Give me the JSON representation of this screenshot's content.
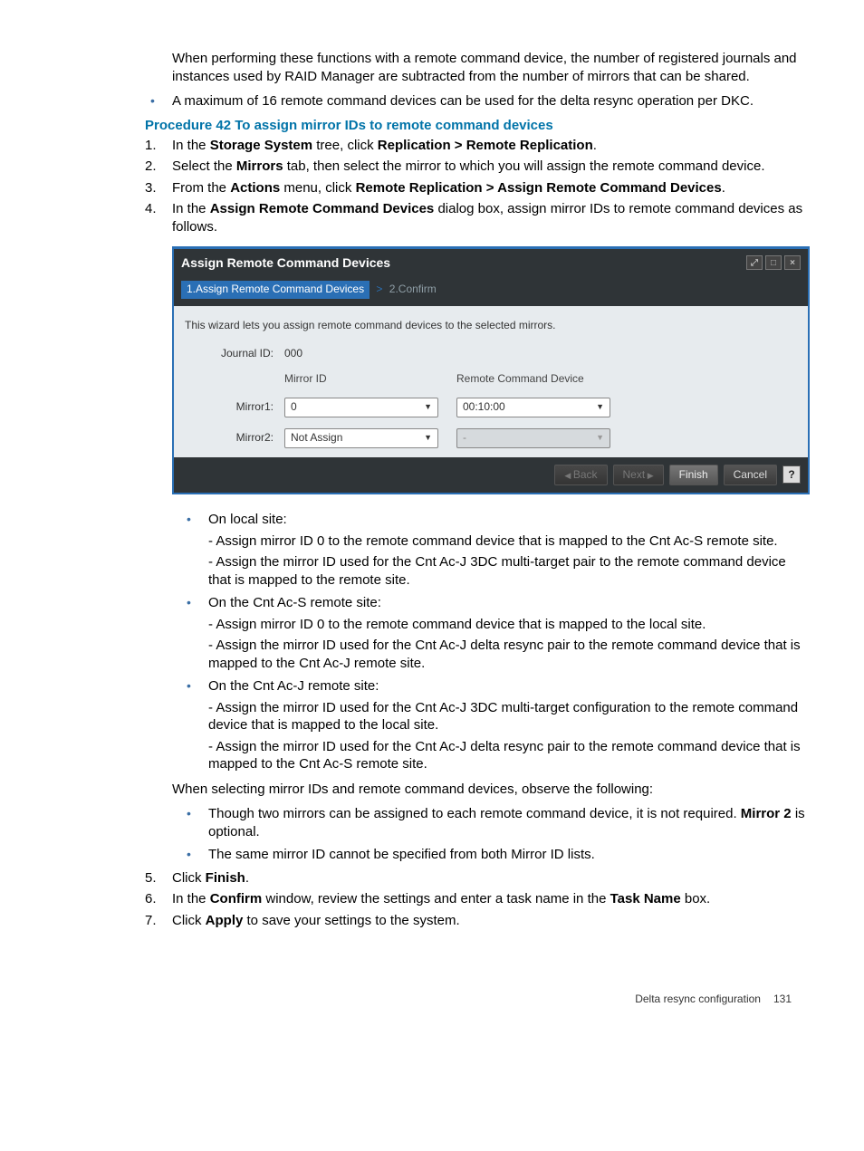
{
  "intro": {
    "p1": "When performing these functions with a remote command device, the number of registered journals and instances used by RAID Manager are subtracted from the number of mirrors that can be shared.",
    "b1": "A maximum of 16 remote command devices can be used for the delta resync operation per DKC."
  },
  "procedure_title": "Procedure 42 To assign mirror IDs to remote command devices",
  "steps": {
    "s1a": "In the ",
    "s1b": "Storage System",
    "s1c": " tree, click ",
    "s1d": "Replication > Remote Replication",
    "s1e": ".",
    "s2a": "Select the ",
    "s2b": "Mirrors",
    "s2c": " tab, then select the mirror to which you will assign the remote command device.",
    "s3a": "From the ",
    "s3b": "Actions",
    "s3c": " menu, click ",
    "s3d": "Remote Replication > Assign Remote Command Devices",
    "s3e": ".",
    "s4a": "In the ",
    "s4b": "Assign Remote Command Devices",
    "s4c": " dialog box, assign mirror IDs to remote command devices as follows."
  },
  "dialog": {
    "title": "Assign Remote Command Devices",
    "crumb_active": "1.Assign Remote Command Devices",
    "crumb_sep": ">",
    "crumb_rest": "2.Confirm",
    "desc": "This wizard lets you assign remote command devices to the selected mirrors.",
    "journal_id_label": "Journal ID:",
    "journal_id_value": "000",
    "col_mirror": "Mirror ID",
    "col_rcd": "Remote Command Device",
    "mirror1_label": "Mirror1:",
    "mirror1_id": "0",
    "mirror1_rcd": "00:10:00",
    "mirror2_label": "Mirror2:",
    "mirror2_id": "Not Assign",
    "mirror2_rcd": "-",
    "btn_back": "Back",
    "btn_next": "Next",
    "btn_finish": "Finish",
    "btn_cancel": "Cancel",
    "btn_help": "?"
  },
  "after": {
    "local_head": "On local site:",
    "local_l1": "- Assign mirror ID 0 to the remote command device that is mapped to the Cnt Ac-S remote site.",
    "local_l2": "- Assign the mirror ID used for the Cnt Ac-J 3DC multi-target pair to the remote command device that is mapped to the remote site.",
    "acs_head": "On the Cnt Ac-S remote site:",
    "acs_l1": "- Assign mirror ID 0 to the remote command device that is mapped to the local site.",
    "acs_l2": "- Assign the mirror ID used for the Cnt Ac-J delta resync pair to the remote command device that is mapped to the Cnt Ac-J remote site.",
    "acj_head": "On the Cnt Ac-J remote site:",
    "acj_l1": "- Assign the mirror ID used for the Cnt Ac-J 3DC multi-target configuration to the remote command device that is mapped to the local site.",
    "acj_l2": "- Assign the mirror ID used for the Cnt Ac-J delta resync pair to the remote command device that is mapped to the Cnt Ac-S remote site.",
    "select_note": "When selecting mirror IDs and remote command devices, observe the following:",
    "obs1a": "Though two mirrors can be assigned to each remote command device, it is not required. ",
    "obs1b": "Mirror 2",
    "obs1c": " is optional.",
    "obs2": "The same mirror ID cannot be specified from both Mirror ID lists.",
    "s5a": "Click ",
    "s5b": "Finish",
    "s5c": ".",
    "s6a": "In the ",
    "s6b": "Confirm",
    "s6c": " window, review the settings and enter a task name in the ",
    "s6d": "Task Name",
    "s6e": " box.",
    "s7a": "Click ",
    "s7b": "Apply",
    "s7c": " to save your settings to the system."
  },
  "footer": {
    "section": "Delta resync configuration",
    "page": "131"
  }
}
